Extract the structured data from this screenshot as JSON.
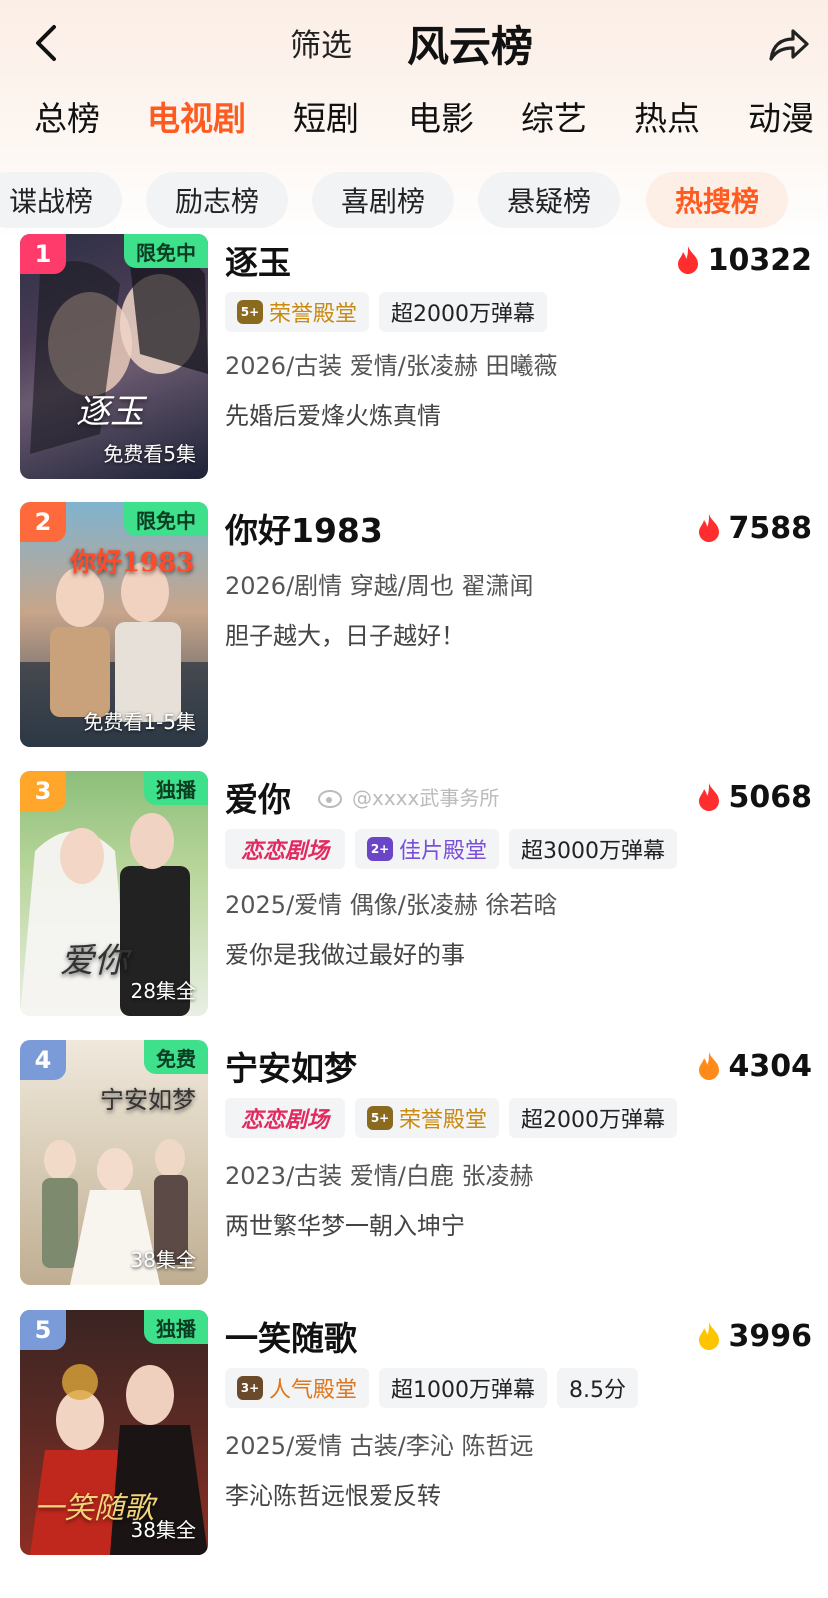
{
  "header": {
    "filter_label": "筛选",
    "title": "风云榜"
  },
  "tabs": [
    "总榜",
    "电视剧",
    "短剧",
    "电影",
    "综艺",
    "热点",
    "动漫"
  ],
  "active_tab": "电视剧",
  "chips": [
    "谍战榜",
    "励志榜",
    "喜剧榜",
    "悬疑榜",
    "热搜榜"
  ],
  "active_chip": "热搜榜",
  "watermark": "@xxxx武事务所",
  "items": [
    {
      "rank": "1",
      "rank_color": "#ff3b6b",
      "tag": "限免中",
      "eps": "免费看5集",
      "poster_title": "逐玉",
      "name": "逐玉",
      "heat": "10322",
      "flame_color": "#ff2d2d",
      "badges": [
        {
          "text": "荣誉殿堂",
          "emblem": "5+",
          "icon": "laurel-badge"
        },
        {
          "text": "超2000万弹幕"
        }
      ],
      "meta": "2026/古装 爱情/张凌赫 田曦薇",
      "desc": "先婚后爱烽火炼真情"
    },
    {
      "rank": "2",
      "rank_color": "#ff6a3d",
      "tag": "限免中",
      "eps": "免费看1-5集",
      "poster_title": "你好1983",
      "name": "你好1983",
      "heat": "7588",
      "flame_color": "#ff2d2d",
      "badges": [],
      "meta": "2026/剧情 穿越/周也 翟潇闻",
      "desc": "胆子越大，日子越好！"
    },
    {
      "rank": "3",
      "rank_color": "#ffa62b",
      "tag": "独播",
      "eps": "28集全",
      "poster_title": "爱你",
      "name": "爱你",
      "heat": "5068",
      "flame_color": "#ff2d2d",
      "badges": [
        {
          "text": "恋恋剧场",
          "style": "red"
        },
        {
          "text": "佳片殿堂",
          "emblem": "2+",
          "style": "purple"
        },
        {
          "text": "超3000万弹幕"
        }
      ],
      "meta": "2025/爱情 偶像/张凌赫 徐若晗",
      "desc": "爱你是我做过最好的事"
    },
    {
      "rank": "4",
      "rank_color": "#7b9bd8",
      "tag": "免费",
      "eps": "38集全",
      "poster_title": "宁安如梦",
      "name": "宁安如梦",
      "heat": "4304",
      "flame_color": "#ff8a1a",
      "badges": [
        {
          "text": "恋恋剧场",
          "style": "red"
        },
        {
          "text": "荣誉殿堂",
          "emblem": "5+",
          "style": "gold"
        },
        {
          "text": "超2000万弹幕"
        }
      ],
      "meta": "2023/古装 爱情/白鹿 张凌赫",
      "desc": "两世繁华梦一朝入坤宁"
    },
    {
      "rank": "5",
      "rank_color": "#7b9bd8",
      "tag": "独播",
      "eps": "38集全",
      "poster_title": "一笑随歌",
      "name": "一笑随歌",
      "heat": "3996",
      "flame_color": "#ffc400",
      "badges": [
        {
          "text": "人气殿堂",
          "emblem": "3+",
          "style": "gold"
        },
        {
          "text": "超1000万弹幕"
        },
        {
          "text": "8.5分"
        }
      ],
      "meta": "2025/爱情 古装/李沁 陈哲远",
      "desc": "李沁陈哲远恨爱反转"
    }
  ]
}
